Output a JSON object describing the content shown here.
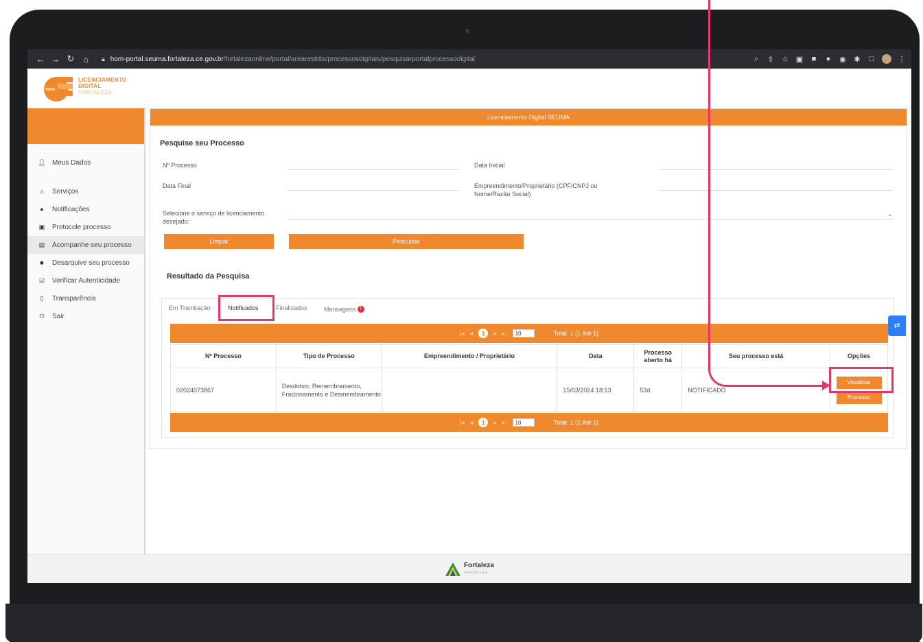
{
  "browser": {
    "url_host": "hom-portal.seuma.fortaleza.ce.gov.br",
    "url_path": "/fortalezaonline/portal/arearestrita/processosdigitais/pesquisarportalprocessodigital"
  },
  "logo": {
    "line1": "LICENCIAMENTO",
    "line2": "DIGITAL",
    "line3": "FORTALEZA"
  },
  "sidebar": {
    "user_item": "Meus Dados",
    "items": [
      {
        "label": "Serviços",
        "icon": "home-icon"
      },
      {
        "label": "Notificações",
        "icon": "alert-icon"
      },
      {
        "label": "Protocole processo",
        "icon": "document-icon"
      },
      {
        "label": "Acompanhe seu processo",
        "icon": "list-icon"
      },
      {
        "label": "Desarquive seu processo",
        "icon": "archive-icon"
      },
      {
        "label": "Verificar Autenticidade",
        "icon": "check-icon"
      },
      {
        "label": "Transparência",
        "icon": "file-icon"
      },
      {
        "label": "Sair",
        "icon": "power-icon"
      }
    ]
  },
  "panel": {
    "title": "Licenciamento Digital SEUMA",
    "heading": "Pesquise seu Processo",
    "labels": {
      "numero": "Nº Processo",
      "data_inicial": "Data Inicial",
      "data_final": "Data Final",
      "empreendimento": "Empreendimento/Proprietário (CPF/CNPJ ou Nome/Razão Social)",
      "servico": "Selecione o serviço de licenciamento desejado:"
    },
    "buttons": {
      "limpar": "Limpar",
      "pesquisar": "Pesquisar"
    },
    "result_heading": "Resultado da Pesquisa"
  },
  "tabs": [
    {
      "label": "Em Tramitação"
    },
    {
      "label": "Notificados"
    },
    {
      "label": "Finalizados"
    },
    {
      "label": "Mensagens"
    }
  ],
  "pager": {
    "current_page": "1",
    "per_page": "10",
    "total": "Total: 1 (1 Até 1)"
  },
  "table": {
    "headers": [
      "Nº Processo",
      "Tipo de Processo",
      "Empreendimento / Proprietário",
      "Data",
      "Processo aberto há",
      "Seu processo está",
      "Opções"
    ],
    "rows": [
      {
        "numero": "02024073867",
        "tipo": "Desdobro, Remembramento, Fracionamento e Desmembramento",
        "empreendimento": "",
        "data": "15/03/2024 18:13",
        "aberto": "53d",
        "status": "NOTIFICADO",
        "btn_visualizar": "Visualizar",
        "btn_processo": "Processo"
      }
    ]
  },
  "footer": {
    "brand": "Fortaleza",
    "sub": "PREFEITURA"
  },
  "colors": {
    "brand_orange": "#f0892e",
    "annotation_pink": "#e8366a"
  }
}
